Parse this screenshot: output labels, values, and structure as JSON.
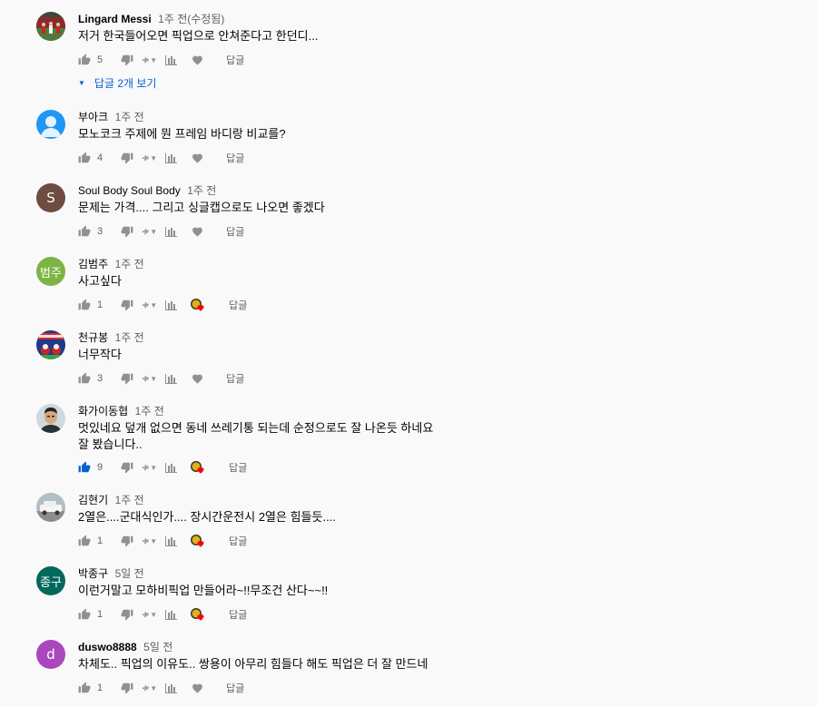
{
  "comments": [
    {
      "author": "Lingard Messi",
      "time": "1주 전(수정됨)",
      "text": "저거 한국들어오면 픽업으로 안쳐준다고 한던디...",
      "likes": "5",
      "avatar": "photo-stadium",
      "liked": false,
      "creator_heart": false
    },
    {
      "author": "부아크",
      "time": "1주 전",
      "text": "모노코크 주제에 뭔 프레임 바디랑 비교를?",
      "likes": "4",
      "avatar": "default-person",
      "avatar_color": "#2196f3",
      "liked": false,
      "creator_heart": false
    },
    {
      "author": "Soul Body Soul Body",
      "time": "1주 전",
      "text": "문제는 가격.... 그리고 싱글캡으로도 나오면 좋겠다",
      "likes": "3",
      "avatar_letter": "S",
      "avatar_color": "#6d4c41",
      "liked": false,
      "creator_heart": false
    },
    {
      "author": "김범주",
      "time": "1주 전",
      "text": "사고싶다",
      "likes": "1",
      "avatar_letter": "범주",
      "avatar_color": "#7cb342",
      "liked": false,
      "creator_heart": true
    },
    {
      "author": "천규봉",
      "time": "1주 전",
      "text": "너무작다",
      "likes": "3",
      "avatar": "photo-santa",
      "liked": false,
      "creator_heart": false
    },
    {
      "author": "화가이동협",
      "time": "1주 전",
      "text": "멋있네요 덮개 없으면 동네 쓰레기통 되는데 순정으로도 잘 나온듯 하네요\n잘 봤습니다..",
      "likes": "9",
      "avatar": "photo-person",
      "liked": true,
      "creator_heart": true
    },
    {
      "author": "김현기",
      "time": "1주 전",
      "text": "2열은....군대식인가.... 장시간운전시 2열은 힘들듯....",
      "likes": "1",
      "avatar": "photo-car",
      "liked": false,
      "creator_heart": true
    },
    {
      "author": "박종구",
      "time": "5일 전",
      "text": "이런거말고 모하비픽업 만들어라~!!무조건 산다~~!!",
      "likes": "1",
      "avatar_letter": "종구",
      "avatar_color": "#00695c",
      "liked": false,
      "creator_heart": true
    },
    {
      "author": "duswo8888",
      "time": "5일 전",
      "text": "차체도.. 픽업의 이유도.. 쌍용이 아무리 힘들다 해도 픽업은 더 잘 만드네",
      "likes": "1",
      "avatar_letter": "d",
      "avatar_color": "#ab47bc",
      "liked": false,
      "creator_heart": false
    }
  ],
  "labels": {
    "reply": "답글",
    "view_replies": "답글 2개 보기",
    "translate": "ቱ",
    "translate_caret": "▼",
    "replies_arrow": "▼"
  },
  "colors": {
    "liked_blue": "#065fd4",
    "icon_gray": "#909090",
    "creator_heart_red": "#ff0000"
  }
}
